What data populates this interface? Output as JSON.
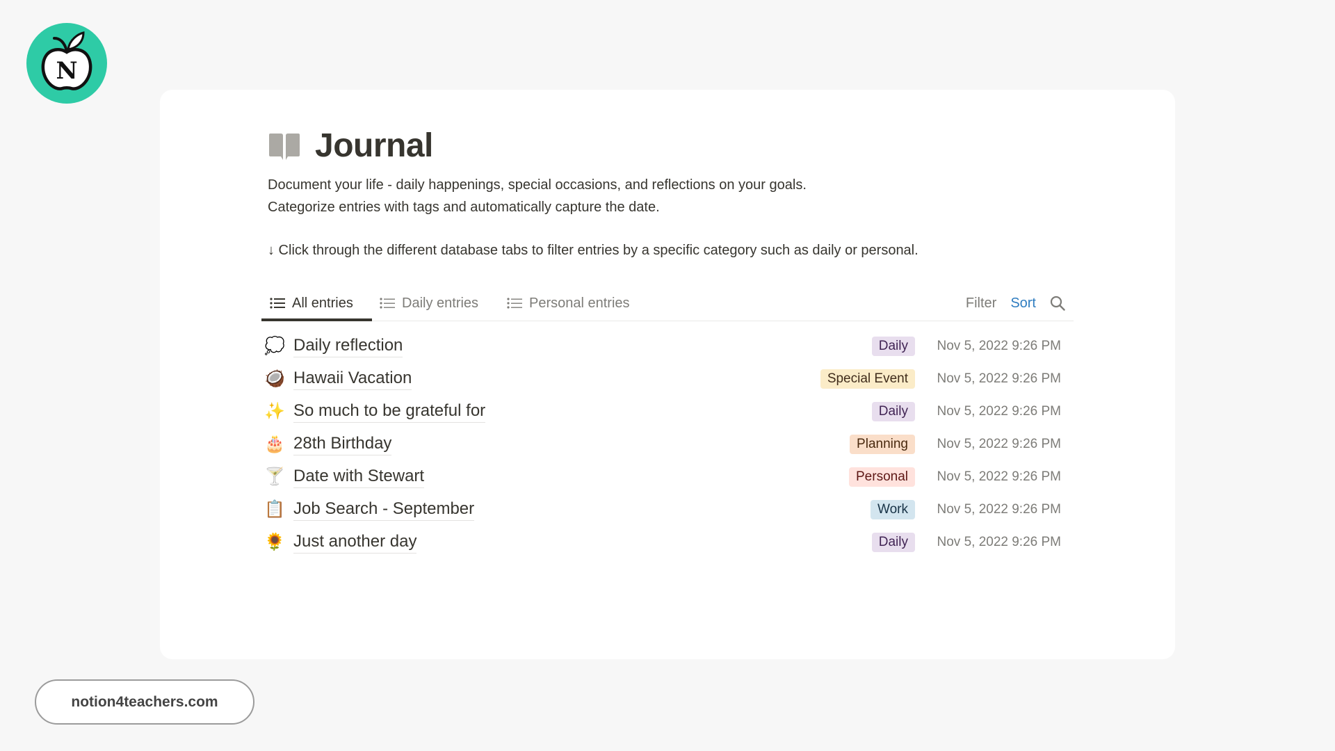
{
  "brand": {
    "logo_letter": "N",
    "logo_color": "#2ecba6",
    "website": "notion4teachers.com"
  },
  "page": {
    "icon": "open-book-icon",
    "title": "Journal",
    "description": [
      "Document your life - daily happenings, special occasions, and reflections on your goals.",
      "Categorize entries with tags and automatically capture the date."
    ],
    "hint": "↓ Click through the different database tabs to filter entries by a specific category such as daily or personal."
  },
  "database": {
    "tabs": [
      {
        "label": "All entries",
        "icon": "list-icon",
        "active": true
      },
      {
        "label": "Daily entries",
        "icon": "list-icon",
        "active": false
      },
      {
        "label": "Personal entries",
        "icon": "list-icon",
        "active": false
      }
    ],
    "toolbar": {
      "filter_label": "Filter",
      "sort_label": "Sort",
      "search_icon": "search-icon"
    },
    "entries": [
      {
        "emoji": "💭",
        "title": "Daily reflection",
        "tag": "Daily",
        "date": "Nov 5, 2022 9:26 PM"
      },
      {
        "emoji": "🥥",
        "title": "Hawaii Vacation",
        "tag": "Special Event",
        "date": "Nov 5, 2022 9:26 PM"
      },
      {
        "emoji": "✨",
        "title": "So much to be grateful for",
        "tag": "Daily",
        "date": "Nov 5, 2022 9:26 PM"
      },
      {
        "emoji": "🎂",
        "title": "28th Birthday",
        "tag": "Planning",
        "date": "Nov 5, 2022 9:26 PM"
      },
      {
        "emoji": "🍸",
        "title": "Date with Stewart",
        "tag": "Personal",
        "date": "Nov 5, 2022 9:26 PM"
      },
      {
        "emoji": "📋",
        "title": "Job Search - September",
        "tag": "Work",
        "date": "Nov 5, 2022 9:26 PM"
      },
      {
        "emoji": "🌻",
        "title": "Just another day",
        "tag": "Daily",
        "date": "Nov 5, 2022 9:26 PM"
      }
    ],
    "tag_colors": {
      "Daily": {
        "bg": "#e8deee",
        "fg": "#412454"
      },
      "Special Event": {
        "bg": "#fbecc8",
        "fg": "#402c1b"
      },
      "Planning": {
        "bg": "#fadec9",
        "fg": "#49290e"
      },
      "Personal": {
        "bg": "#ffe2dd",
        "fg": "#5d1715"
      },
      "Work": {
        "bg": "#d3e5ef",
        "fg": "#183347"
      }
    }
  }
}
